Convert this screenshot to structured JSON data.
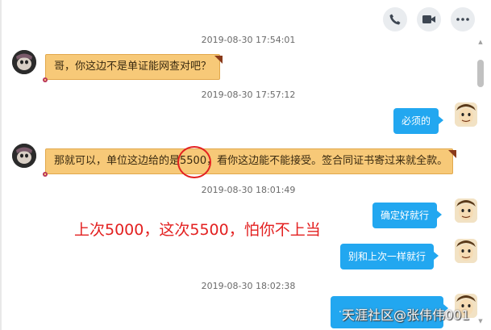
{
  "toolbar": {
    "icons": [
      "phone-icon",
      "video-icon",
      "more-icon"
    ]
  },
  "messages": [
    {
      "timestamp": "2019-08-30 17:54:01"
    },
    {
      "side": "left",
      "text": "哥，你这边不是单证能网查对吧？"
    },
    {
      "timestamp": "2019-08-30 17:57:12"
    },
    {
      "side": "right",
      "text": "必须的"
    },
    {
      "side": "left",
      "text_before": "那就可以，单位这边给的是",
      "highlight": "5500",
      "text_after": "，看你这边能不能接受。签合同证书寄过来就全款。"
    },
    {
      "timestamp": "2019-08-30 18:01:49"
    },
    {
      "side": "right",
      "text": "确定好就行"
    },
    {
      "side": "right",
      "text": "别和上次一样就行"
    },
    {
      "timestamp": "2019-08-30 18:02:38"
    },
    {
      "side": "right",
      "text": "...."
    }
  ],
  "annotation": {
    "text": "上次5000，这次5500，怕你不上当",
    "color": "#e32020"
  },
  "watermark": "天涯社区@张伟伟001",
  "colors": {
    "bubble_in": "#f7c978",
    "bubble_out": "#22a7f0"
  }
}
